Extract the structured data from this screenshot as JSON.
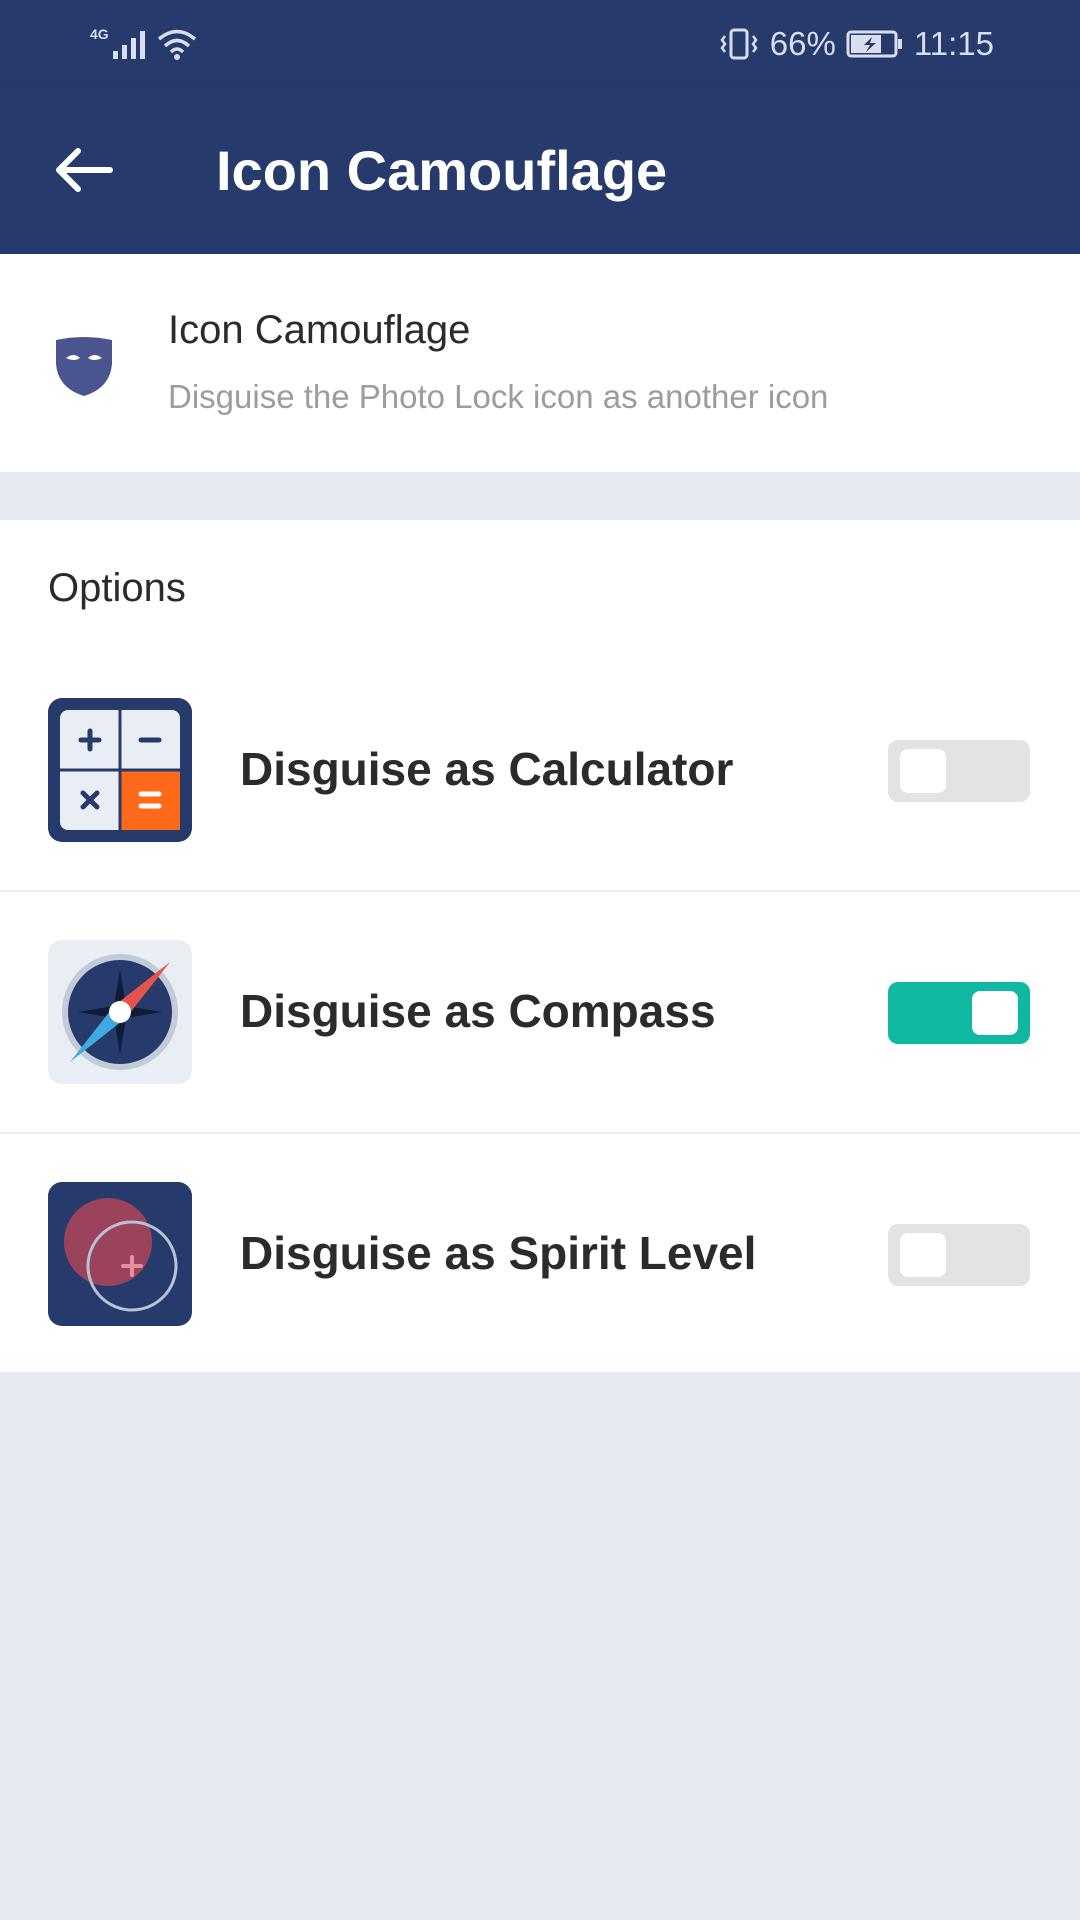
{
  "status_bar": {
    "network": "4G",
    "battery_percent": "66%",
    "time": "11:15"
  },
  "app_bar": {
    "title": "Icon Camouflage",
    "back_icon": "arrow-left-icon"
  },
  "header": {
    "icon": "mask-icon",
    "title": "Icon Camouflage",
    "subtitle": "Disguise the Photo Lock icon as another icon"
  },
  "options": {
    "label": "Options",
    "items": [
      {
        "icon": "calculator-icon",
        "label": "Disguise as Calculator",
        "enabled": false
      },
      {
        "icon": "compass-icon",
        "label": "Disguise as Compass",
        "enabled": true
      },
      {
        "icon": "spirit-level-icon",
        "label": "Disguise as Spirit Level",
        "enabled": false
      }
    ]
  },
  "colors": {
    "primary": "#263a6b",
    "toggle_on": "#0fb8a0",
    "toggle_off": "#e3e3e3",
    "calculator_accent": "#ff6a1a",
    "background": "#e7eaf3"
  }
}
